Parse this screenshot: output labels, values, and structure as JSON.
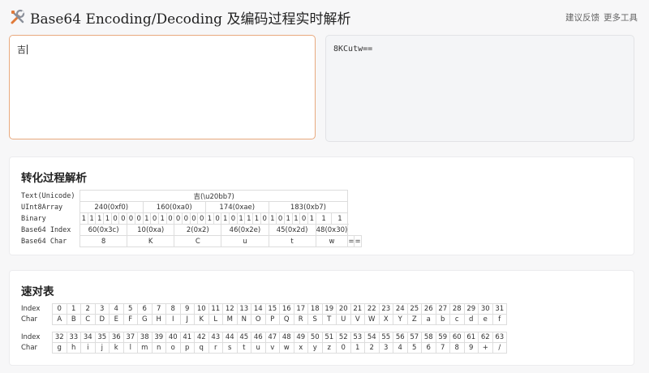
{
  "header": {
    "title": "Base64 Encoding/Decoding 及编码过程实时解析",
    "links": [
      "建议反馈",
      "更多工具"
    ]
  },
  "input": {
    "value": "吉"
  },
  "output": {
    "value": "8KCutw=="
  },
  "process": {
    "title": "转化过程解析",
    "labels": {
      "text": "Text(Unicode)",
      "uint8": "UInt8Array",
      "binary": "Binary",
      "index": "Base64 Index",
      "char": "Base64 Char"
    },
    "text_value": "吉(\\u20bb7)",
    "uint8": [
      "240(0xf0)",
      "160(0xa0)",
      "174(0xae)",
      "183(0xb7)"
    ],
    "binary": "11110000101000001010111010110111",
    "index": [
      "60(0x3c)",
      "10(0xa)",
      "2(0x2)",
      "46(0x2e)",
      "45(0x2d)",
      "48(0x30)"
    ],
    "char": [
      "8",
      "K",
      "C",
      "u",
      "t",
      "w",
      "=",
      "="
    ]
  },
  "quick": {
    "title": "速对表",
    "index_label": "Index",
    "char_label": "Char",
    "chars": "ABCDEFGHIJKLMNOPQRSTUVWXYZabcdefghijklmnopqrstuvwxyz0123456789+/"
  },
  "colors": {
    "accent_border": "#e8a97e",
    "cell_border": "#dddddd"
  }
}
